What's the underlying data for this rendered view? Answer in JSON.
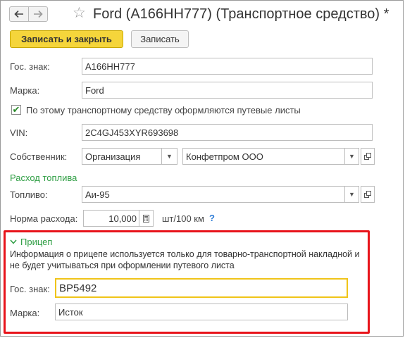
{
  "window": {
    "title": "Ford (А166НН777) (Транспортное средство) *"
  },
  "toolbar": {
    "save_close_label": "Записать и закрыть",
    "save_label": "Записать"
  },
  "form": {
    "gos_znak": {
      "label": "Гос. знак:",
      "value": "А166НН777"
    },
    "marka": {
      "label": "Марка:",
      "value": "Ford"
    },
    "waybill_checkbox": {
      "label": "По этому транспортному средству оформляются путевые листы",
      "checked": true
    },
    "vin": {
      "label": "VIN:",
      "value": "2C4GJ453XYR693698"
    },
    "owner": {
      "label": "Собственник:",
      "type_value": "Организация",
      "value": "Конфетпром ООО"
    },
    "fuel_section": {
      "title": "Расход топлива"
    },
    "fuel": {
      "label": "Топливо:",
      "value": "Аи-95"
    },
    "rate": {
      "label": "Норма расхода:",
      "value": "10,000",
      "unit": "шт/100 км",
      "help": "?"
    }
  },
  "trailer": {
    "title": "Прицеп",
    "info": "Информация о прицепе используется только для товарно-транспортной накладной и не будет учитываться при оформлении путевого листа",
    "gos_znak": {
      "label": "Гос. знак:",
      "value": "ВР5492"
    },
    "marka": {
      "label": "Марка:",
      "value": "Исток"
    }
  },
  "colors": {
    "accent_yellow": "#f5d53b",
    "section_green": "#2f9e44",
    "highlight_red": "#e8141b",
    "focus_yellow": "#f0c419",
    "help_blue": "#2c7bd6"
  },
  "icons": [
    "arrow-left-icon",
    "arrow-right-icon",
    "star-icon",
    "chevron-down-icon",
    "open-icon",
    "calculator-icon",
    "chevron-down-icon"
  ]
}
